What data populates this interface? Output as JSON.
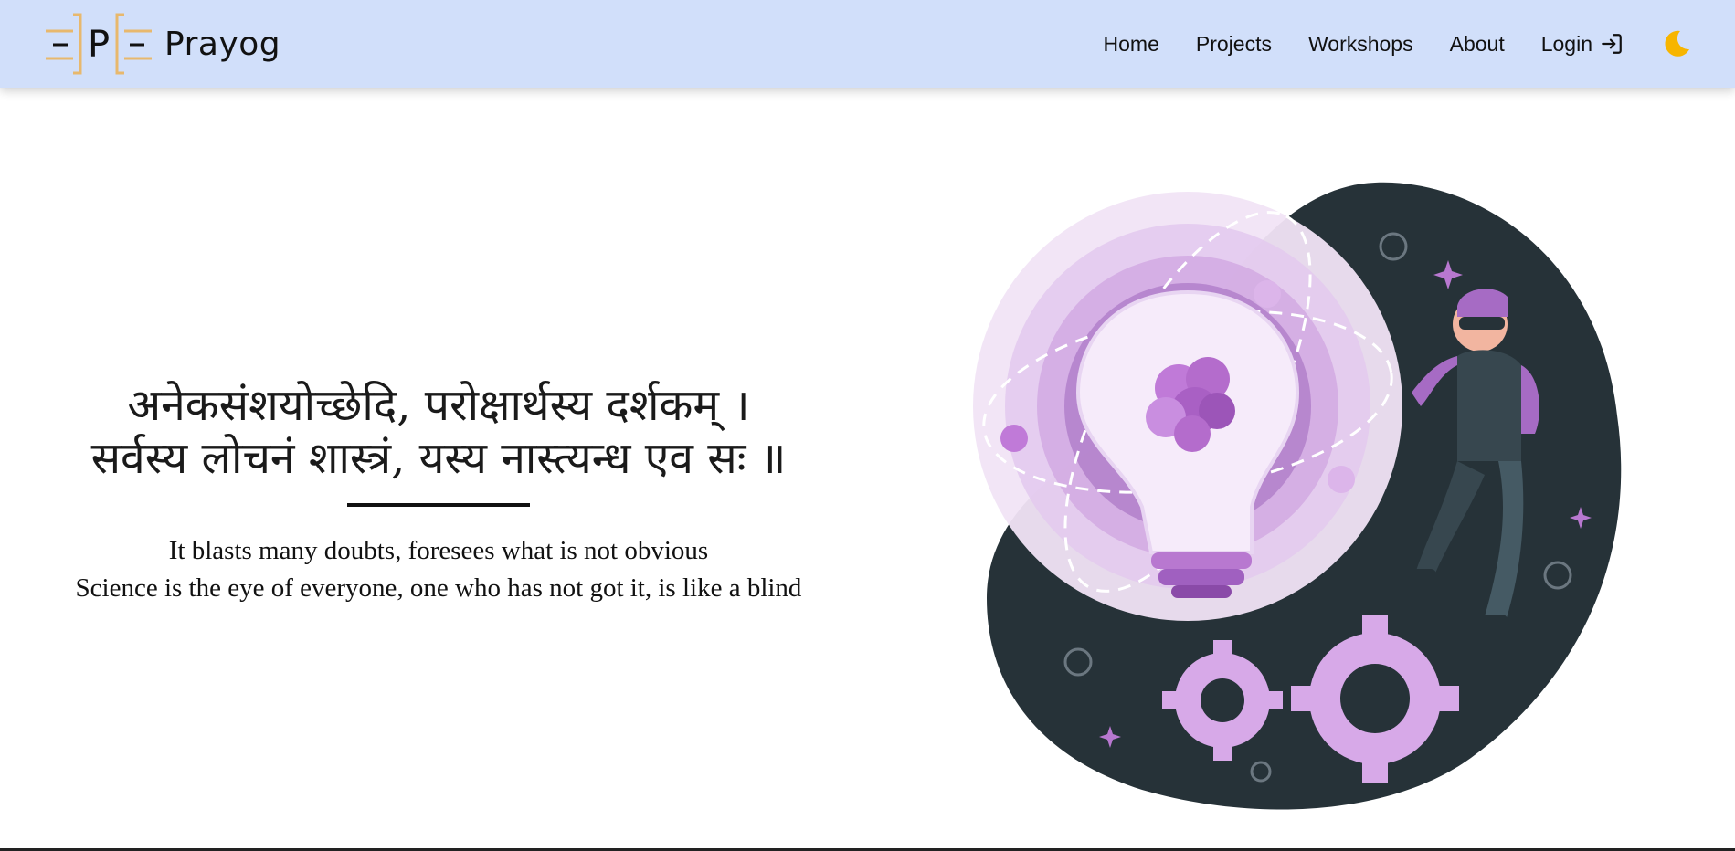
{
  "brand": {
    "logo_letter": "P",
    "name": "Prayog"
  },
  "nav": {
    "items": [
      {
        "label": "Home"
      },
      {
        "label": "Projects"
      },
      {
        "label": "Workshops"
      },
      {
        "label": "About"
      },
      {
        "label": "Login"
      }
    ],
    "login_icon": "login-arrow-icon",
    "theme_icon": "moon-icon"
  },
  "hero": {
    "sanskrit_line_1": "अनेकसंशयोच्छेदि, परोक्षार्थस्य दर्शकम् ।",
    "sanskrit_line_2": "सर्वस्य लोचनं शास्त्रं, यस्य नास्त्यन्ध एव सः ॥",
    "translation_line_1": "It blasts many doubts, foresees what is not obvious",
    "translation_line_2": "Science is the eye of everyone, one who has not got it, is like a blind"
  },
  "illustration": {
    "description_icon": "science-lightbulb-illustration"
  },
  "colors": {
    "navbar_bg": "#d1dffa",
    "accent_gold": "#e8b86d",
    "moon": "#f7b500",
    "purple": "#b878d0",
    "dark_blob": "#263238"
  }
}
